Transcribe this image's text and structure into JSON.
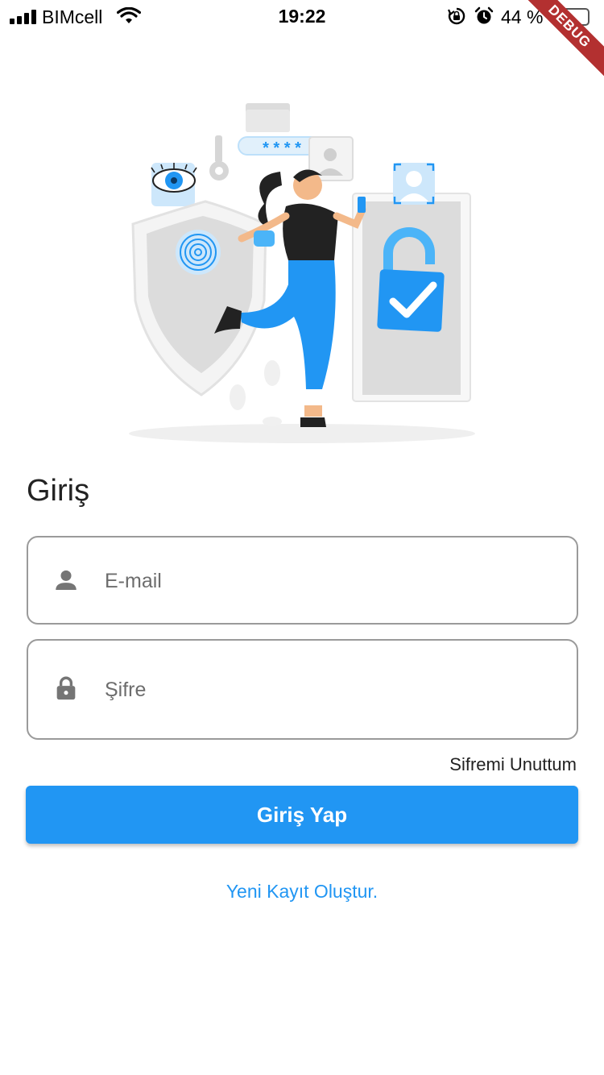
{
  "status_bar": {
    "carrier": "BIMcell",
    "time": "19:22",
    "battery_percent": "44 %",
    "battery_level": 0.44,
    "debug_label": "DEBUG",
    "icons": [
      "signal-icon",
      "wifi-icon",
      "rotation-lock-icon",
      "alarm-icon",
      "battery-icon"
    ]
  },
  "login": {
    "title": "Giriş",
    "email_placeholder": "E-mail",
    "password_placeholder": "Şifre",
    "forgot_label": "Sifremi Unuttum",
    "submit_label": "Giriş Yap",
    "register_label": "Yeni Kayıt Oluştur.",
    "icons": {
      "email": "person-icon",
      "password": "lock-icon"
    }
  },
  "illustration": {
    "password_mask": "* * * *"
  },
  "colors": {
    "accent": "#2196f3",
    "border": "#9a9a9a",
    "debug": "#b33030"
  }
}
